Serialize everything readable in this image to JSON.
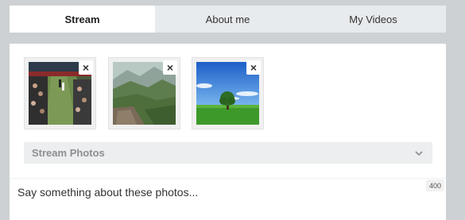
{
  "tabs": [
    {
      "label": "Stream",
      "active": true
    },
    {
      "label": "About me",
      "active": false
    },
    {
      "label": "My Videos",
      "active": false
    }
  ],
  "photos": [
    {
      "name": "stadium-crowd-photo",
      "close_label": "×"
    },
    {
      "name": "mountain-valley-photo",
      "close_label": "×"
    },
    {
      "name": "field-tree-photo",
      "close_label": "×"
    }
  ],
  "album_select": {
    "selected": "Stream Photos",
    "icon": "chevron-down-icon"
  },
  "composer": {
    "placeholder": "Say something about these photos...",
    "char_limit": "400"
  },
  "colors": {
    "background": "#cdd1d4",
    "panel": "#ffffff",
    "inactive_tab": "#e8ebed",
    "select_bg": "#eceeef"
  }
}
